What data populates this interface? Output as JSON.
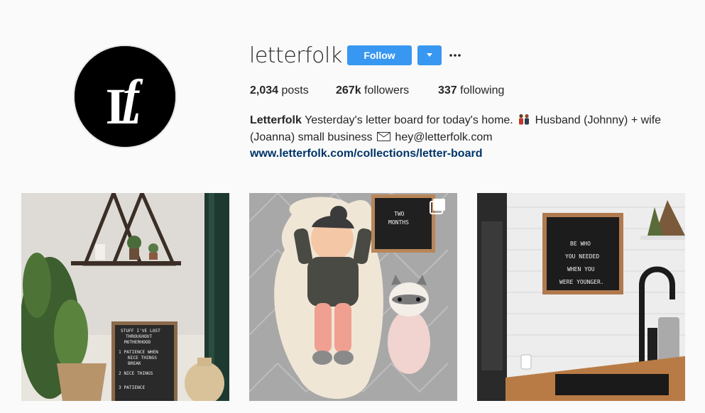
{
  "profile": {
    "username": "letterfolk",
    "avatar_icon": "letterfolk-logo",
    "follow_label": "Follow",
    "dropdown_icon": "caret-down-icon",
    "more_icon": "ellipsis-icon"
  },
  "stats": {
    "posts_count": "2,034",
    "posts_label": " posts",
    "followers_count": "267k",
    "followers_label": " followers",
    "following_count": "337",
    "following_label": " following"
  },
  "bio": {
    "name": "Letterfolk",
    "text_1": " Yesterday's letter board for today's home. ",
    "text_2": " Husband (Johnny) + wife (Joanna) small business ",
    "text_3": " hey@letterfolk.com",
    "link": "www.letterfolk.com/collections/letter-board"
  },
  "posts": [
    {
      "board_lines": [
        "STUFF I'VE LOST",
        "THROUGHOUT",
        "MOTHERHOOD",
        "1  PATIENCE WHEN",
        "NICE THINGS",
        "BREAK",
        "2  NICE THINGS",
        "3  PATIENCE"
      ]
    },
    {
      "board_lines": [
        "TWO",
        "MONTHS"
      ],
      "multi_icon": "multiple-posts-icon"
    },
    {
      "board_lines": [
        "BE  WHO",
        "YOU  NEEDED",
        "WHEN  YOU",
        "WERE  YOUNGER."
      ]
    }
  ],
  "colors": {
    "accent": "#3897f0",
    "link": "#003569",
    "background": "#fafafa"
  }
}
